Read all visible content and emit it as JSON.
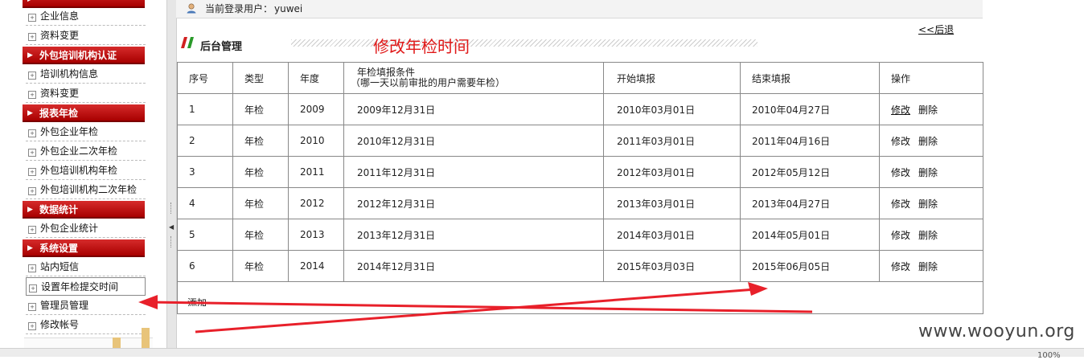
{
  "sidebar": {
    "items_top": [
      {
        "label": "企业信息"
      },
      {
        "label": "资料变更"
      }
    ],
    "sections": [
      {
        "title": "外包培训机构认证",
        "items": [
          {
            "label": "培训机构信息"
          },
          {
            "label": "资料变更"
          }
        ]
      },
      {
        "title": "报表年检",
        "items": [
          {
            "label": "外包企业年检"
          },
          {
            "label": "外包企业二次年检"
          },
          {
            "label": "外包培训机构年检"
          },
          {
            "label": "外包培训机构二次年检"
          }
        ]
      },
      {
        "title": "数据统计",
        "items": [
          {
            "label": "外包企业统计"
          }
        ]
      },
      {
        "title": "系统设置",
        "items": [
          {
            "label": "站内短信"
          },
          {
            "label": "设置年检提交时间"
          },
          {
            "label": "管理员管理"
          },
          {
            "label": "修改帐号"
          }
        ]
      }
    ]
  },
  "topbar": {
    "label": "当前登录用户：",
    "username": "yuwei"
  },
  "header": {
    "back": "<<后退",
    "title": "后台管理",
    "annotation": "修改年检时间"
  },
  "table": {
    "headers": [
      "序号",
      "类型",
      "年度",
      "年检填报条件",
      "（哪一天以前审批的用户需要年检）",
      "开始填报",
      "结束填报",
      "操作"
    ],
    "rows": [
      {
        "no": "1",
        "type": "年检",
        "year": "2009",
        "cond": "2009年12月31日",
        "start": "2010年03月01日",
        "end": "2010年04月27日"
      },
      {
        "no": "2",
        "type": "年检",
        "year": "2010",
        "cond": "2010年12月31日",
        "start": "2011年03月01日",
        "end": "2011年04月16日"
      },
      {
        "no": "3",
        "type": "年检",
        "year": "2011",
        "cond": "2011年12月31日",
        "start": "2012年03月01日",
        "end": "2012年05月12日"
      },
      {
        "no": "4",
        "type": "年检",
        "year": "2012",
        "cond": "2012年12月31日",
        "start": "2013年03月01日",
        "end": "2013年04月27日"
      },
      {
        "no": "5",
        "type": "年检",
        "year": "2013",
        "cond": "2013年12月31日",
        "start": "2014年03月01日",
        "end": "2014年05月01日"
      },
      {
        "no": "6",
        "type": "年检",
        "year": "2014",
        "cond": "2014年12月31日",
        "start": "2015年03月03日",
        "end": "2015年06月05日"
      }
    ],
    "edit_label": "修改",
    "delete_label": "删除",
    "add_label": "添加"
  },
  "status": {
    "zoom": "100%"
  },
  "watermark": "www.wooyun.org",
  "colors": {
    "section_red": "#c00000",
    "annotation_red": "#e01818",
    "arrow_red": "#e8202a"
  }
}
